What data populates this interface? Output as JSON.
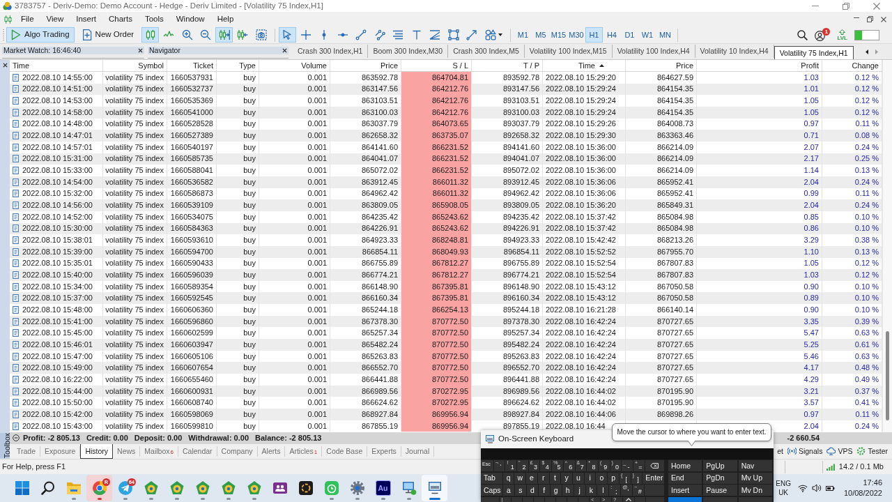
{
  "window": {
    "title": "3783757 - Deriv-Demo: Demo Account - Hedge - Deriv Limited - [Volatility 75 Index,H1]"
  },
  "menu": [
    "File",
    "View",
    "Insert",
    "Charts",
    "Tools",
    "Window",
    "Help"
  ],
  "toolbar": {
    "buttons": [
      {
        "kind": "algo",
        "label": "Algo Trading",
        "selected": true
      },
      {
        "kind": "order",
        "label": "New Order",
        "selected": false
      }
    ],
    "chart_tools": [
      {
        "kind": "bars",
        "selected": true
      },
      {
        "kind": "line",
        "selected": false
      },
      {
        "kind": "zoomin",
        "selected": false
      },
      {
        "kind": "zoomout",
        "selected": false
      },
      {
        "kind": "shift",
        "selected": true
      },
      {
        "kind": "autoscroll",
        "selected": false
      },
      {
        "kind": "screenshot",
        "selected": false
      }
    ],
    "draw_tools": [
      {
        "kind": "cursor",
        "selected": true
      },
      {
        "kind": "crosshair",
        "selected": false
      },
      {
        "kind": "vline",
        "selected": false
      },
      {
        "kind": "hline",
        "selected": false
      },
      {
        "kind": "trend",
        "selected": false
      },
      {
        "kind": "channel",
        "selected": false
      },
      {
        "kind": "fibo",
        "selected": false
      },
      {
        "kind": "text",
        "selected": false
      },
      {
        "kind": "fan",
        "selected": false
      },
      {
        "kind": "rect",
        "selected": false
      },
      {
        "kind": "arrow",
        "selected": false
      },
      {
        "kind": "shapes",
        "selected": false
      }
    ],
    "timeframes": [
      {
        "label": "M1",
        "selected": false
      },
      {
        "label": "M5",
        "selected": false
      },
      {
        "label": "M15",
        "selected": false
      },
      {
        "label": "M30",
        "selected": false
      },
      {
        "label": "H1",
        "selected": true
      },
      {
        "label": "H4",
        "selected": false
      },
      {
        "label": "D1",
        "selected": false
      },
      {
        "label": "W1",
        "selected": false
      },
      {
        "label": "MN",
        "selected": false
      }
    ],
    "notifications_badge": "1",
    "level_label": "LVL",
    "meter": {
      "level": 0.28
    }
  },
  "panels": [
    {
      "title": "Market Watch: 16:46:40"
    },
    {
      "title": "Navigator"
    }
  ],
  "chart_tabs": [
    {
      "label": "Crash 300 Index,H1",
      "selected": false
    },
    {
      "label": "Boom 300 Index,M30",
      "selected": false
    },
    {
      "label": "Crash 300 Index,M5",
      "selected": false
    },
    {
      "label": "Volatility 100 Index,M15",
      "selected": false
    },
    {
      "label": "Volatility 100 Index,H4",
      "selected": false
    },
    {
      "label": "Volatility 10 Index,H4",
      "selected": false
    },
    {
      "label": "Volatility 75 Index,H1",
      "selected": true
    }
  ],
  "table": {
    "columns": [
      {
        "label": "Time",
        "sorted": false,
        "highlighted": false
      },
      {
        "label": "Symbol",
        "sorted": false,
        "highlighted": false
      },
      {
        "label": "Ticket",
        "sorted": false,
        "highlighted": false
      },
      {
        "label": "Type",
        "sorted": false,
        "highlighted": false
      },
      {
        "label": "Volume",
        "sorted": false,
        "highlighted": false
      },
      {
        "label": "Price",
        "sorted": false,
        "highlighted": false
      },
      {
        "label": "S / L",
        "sorted": false,
        "highlighted": true
      },
      {
        "label": "T / P",
        "sorted": false,
        "highlighted": false
      },
      {
        "label": "Time",
        "sorted": true,
        "highlighted": false
      },
      {
        "label": "Price",
        "sorted": false,
        "highlighted": false
      },
      {
        "label": "Profit",
        "sorted": false,
        "highlighted": false
      },
      {
        "label": "Change",
        "sorted": false,
        "highlighted": false
      }
    ],
    "rows": [
      {
        "cells": [
          "2022.08.10 14:55:00",
          "volatility 75 index",
          "1660537931",
          "buy",
          "0.001",
          "863592.78",
          "864704.81",
          "893592.78",
          "2022.08.10 15:29:20",
          "864627.59",
          "1.03",
          "0.12 %"
        ]
      },
      {
        "cells": [
          "2022.08.10 14:51:00",
          "volatility 75 index",
          "1660532737",
          "buy",
          "0.001",
          "863147.56",
          "864212.76",
          "893147.56",
          "2022.08.10 15:29:24",
          "864154.35",
          "1.01",
          "0.12 %"
        ]
      },
      {
        "cells": [
          "2022.08.10 14:53:00",
          "volatility 75 index",
          "1660535369",
          "buy",
          "0.001",
          "863103.51",
          "864212.76",
          "893103.51",
          "2022.08.10 15:29:24",
          "864154.35",
          "1.05",
          "0.12 %"
        ]
      },
      {
        "cells": [
          "2022.08.10 14:58:00",
          "volatility 75 index",
          "1660541000",
          "buy",
          "0.001",
          "863100.03",
          "864212.76",
          "893100.03",
          "2022.08.10 15:29:24",
          "864154.35",
          "1.05",
          "0.12 %"
        ]
      },
      {
        "cells": [
          "2022.08.10 14:48:00",
          "volatility 75 index",
          "1660528528",
          "buy",
          "0.001",
          "863037.79",
          "864073.65",
          "893037.79",
          "2022.08.10 15:29:26",
          "864008.73",
          "0.97",
          "0.11 %"
        ]
      },
      {
        "cells": [
          "2022.08.10 14:47:01",
          "volatility 75 index",
          "1660527389",
          "buy",
          "0.001",
          "862658.32",
          "863735.07",
          "892658.32",
          "2022.08.10 15:29:30",
          "863363.46",
          "0.71",
          "0.08 %"
        ]
      },
      {
        "cells": [
          "2022.08.10 14:57:01",
          "volatility 75 index",
          "1660540197",
          "buy",
          "0.001",
          "864141.60",
          "866231.52",
          "894141.60",
          "2022.08.10 15:36:00",
          "866214.09",
          "2.07",
          "0.24 %"
        ]
      },
      {
        "cells": [
          "2022.08.10 15:31:00",
          "volatility 75 index",
          "1660585735",
          "buy",
          "0.001",
          "864041.07",
          "866231.52",
          "894041.07",
          "2022.08.10 15:36:00",
          "866214.09",
          "2.17",
          "0.25 %"
        ]
      },
      {
        "cells": [
          "2022.08.10 15:33:00",
          "volatility 75 index",
          "1660588041",
          "buy",
          "0.001",
          "865072.02",
          "866231.52",
          "895072.02",
          "2022.08.10 15:36:00",
          "866214.09",
          "1.14",
          "0.13 %"
        ]
      },
      {
        "cells": [
          "2022.08.10 14:54:00",
          "volatility 75 index",
          "1660536582",
          "buy",
          "0.001",
          "863912.45",
          "866011.32",
          "893912.45",
          "2022.08.10 15:36:06",
          "865952.41",
          "2.04",
          "0.24 %"
        ]
      },
      {
        "cells": [
          "2022.08.10 15:32:00",
          "volatility 75 index",
          "1660586873",
          "buy",
          "0.001",
          "864962.42",
          "866011.32",
          "894962.42",
          "2022.08.10 15:36:06",
          "865952.41",
          "0.99",
          "0.11 %"
        ]
      },
      {
        "cells": [
          "2022.08.10 14:56:00",
          "volatility 75 index",
          "1660539109",
          "buy",
          "0.001",
          "863809.05",
          "865908.05",
          "893809.05",
          "2022.08.10 15:36:20",
          "865849.31",
          "2.04",
          "0.24 %"
        ]
      },
      {
        "cells": [
          "2022.08.10 14:52:00",
          "volatility 75 index",
          "1660534075",
          "buy",
          "0.001",
          "864235.42",
          "865243.62",
          "894235.42",
          "2022.08.10 15:37:42",
          "865084.98",
          "0.85",
          "0.10 %"
        ]
      },
      {
        "cells": [
          "2022.08.10 15:30:00",
          "volatility 75 index",
          "1660584363",
          "buy",
          "0.001",
          "864226.91",
          "865243.62",
          "894226.91",
          "2022.08.10 15:37:42",
          "865084.98",
          "0.86",
          "0.10 %"
        ]
      },
      {
        "cells": [
          "2022.08.10 15:38:01",
          "volatility 75 index",
          "1660593610",
          "buy",
          "0.001",
          "864923.33",
          "868248.81",
          "894923.33",
          "2022.08.10 15:42:42",
          "868213.26",
          "3.29",
          "0.38 %"
        ]
      },
      {
        "cells": [
          "2022.08.10 15:39:00",
          "volatility 75 index",
          "1660594700",
          "buy",
          "0.001",
          "866854.11",
          "868049.93",
          "896854.11",
          "2022.08.10 15:52:52",
          "867955.70",
          "1.10",
          "0.13 %"
        ]
      },
      {
        "cells": [
          "2022.08.10 15:35:01",
          "volatility 75 index",
          "1660590433",
          "buy",
          "0.001",
          "866755.89",
          "867812.27",
          "896755.89",
          "2022.08.10 15:52:54",
          "867807.83",
          "1.05",
          "0.12 %"
        ]
      },
      {
        "cells": [
          "2022.08.10 15:40:00",
          "volatility 75 index",
          "1660596039",
          "buy",
          "0.001",
          "866774.21",
          "867812.27",
          "896774.21",
          "2022.08.10 15:52:54",
          "867807.83",
          "1.03",
          "0.12 %"
        ]
      },
      {
        "cells": [
          "2022.08.10 15:34:00",
          "volatility 75 index",
          "1660589354",
          "buy",
          "0.001",
          "866148.90",
          "867395.81",
          "896148.90",
          "2022.08.10 15:43:12",
          "867050.58",
          "0.90",
          "0.10 %"
        ]
      },
      {
        "cells": [
          "2022.08.10 15:37:00",
          "volatility 75 index",
          "1660592545",
          "buy",
          "0.001",
          "866160.34",
          "867395.81",
          "896160.34",
          "2022.08.10 15:43:12",
          "867050.58",
          "0.89",
          "0.10 %"
        ]
      },
      {
        "cells": [
          "2022.08.10 15:48:00",
          "volatility 75 index",
          "1660606360",
          "buy",
          "0.001",
          "865244.18",
          "866254.13",
          "895244.18",
          "2022.08.10 16:21:28",
          "866140.14",
          "0.90",
          "0.10 %"
        ]
      },
      {
        "cells": [
          "2022.08.10 15:41:00",
          "volatility 75 index",
          "1660596860",
          "buy",
          "0.001",
          "867378.30",
          "870772.50",
          "897378.30",
          "2022.08.10 16:42:24",
          "870727.65",
          "3.35",
          "0.39 %"
        ]
      },
      {
        "cells": [
          "2022.08.10 15:45:00",
          "volatility 75 index",
          "1660602599",
          "buy",
          "0.001",
          "865257.34",
          "870772.50",
          "895257.34",
          "2022.08.10 16:42:24",
          "870727.65",
          "5.47",
          "0.63 %"
        ]
      },
      {
        "cells": [
          "2022.08.10 15:46:01",
          "volatility 75 index",
          "1660603947",
          "buy",
          "0.001",
          "865482.24",
          "870772.50",
          "895482.24",
          "2022.08.10 16:42:24",
          "870727.65",
          "5.25",
          "0.61 %"
        ]
      },
      {
        "cells": [
          "2022.08.10 15:47:00",
          "volatility 75 index",
          "1660605106",
          "buy",
          "0.001",
          "865263.83",
          "870772.50",
          "895263.83",
          "2022.08.10 16:42:24",
          "870727.65",
          "5.46",
          "0.63 %"
        ]
      },
      {
        "cells": [
          "2022.08.10 15:49:00",
          "volatility 75 index",
          "1660607654",
          "buy",
          "0.001",
          "866552.70",
          "870772.50",
          "896552.70",
          "2022.08.10 16:42:24",
          "870727.65",
          "4.17",
          "0.48 %"
        ]
      },
      {
        "cells": [
          "2022.08.10 16:22:00",
          "volatility 75 index",
          "1660655460",
          "buy",
          "0.001",
          "866441.88",
          "870772.50",
          "896441.88",
          "2022.08.10 16:42:24",
          "870727.65",
          "4.29",
          "0.49 %"
        ]
      },
      {
        "cells": [
          "2022.08.10 15:44:00",
          "volatility 75 index",
          "1660600931",
          "buy",
          "0.001",
          "866989.56",
          "870272.95",
          "896989.56",
          "2022.08.10 16:44:02",
          "870195.90",
          "3.21",
          "0.37 %"
        ]
      },
      {
        "cells": [
          "2022.08.10 15:50:00",
          "volatility 75 index",
          "1660608740",
          "buy",
          "0.001",
          "866624.62",
          "870272.95",
          "896624.62",
          "2022.08.10 16:44:02",
          "870195.90",
          "3.57",
          "0.41 %"
        ]
      },
      {
        "cells": [
          "2022.08.10 15:42:00",
          "volatility 75 index",
          "1660598069",
          "buy",
          "0.001",
          "868927.84",
          "869956.94",
          "898927.84",
          "2022.08.10 16:44:06",
          "869898.26",
          "0.97",
          "0.11 %"
        ]
      },
      {
        "cells": [
          "2022.08.10 15:43:00",
          "volatility 75 index",
          "1660599810",
          "buy",
          "0.001",
          "867855.19",
          "869956.94",
          "897855.19",
          "2022.08.10 16:44",
          null,
          "2.04",
          "0.24 %"
        ]
      }
    ]
  },
  "summary": {
    "items": [
      "Profit: -2 805.13",
      "Credit: 0.00",
      "Deposit: 0.00",
      "Withdrawal: 0.00",
      "Balance: -2 805.13"
    ],
    "total": "-2 660.54"
  },
  "toolbox": {
    "label": "Toolbox",
    "tabs": [
      {
        "label": "Trade",
        "selected": false
      },
      {
        "label": "Exposure",
        "selected": false
      },
      {
        "label": "History",
        "selected": true
      },
      {
        "label": "News",
        "selected": false
      },
      {
        "label": "Mailbox",
        "selected": false,
        "badge": "6"
      },
      {
        "label": "Calendar",
        "selected": false
      },
      {
        "label": "Company",
        "selected": false
      },
      {
        "label": "Alerts",
        "selected": false
      },
      {
        "label": "Articles",
        "selected": false,
        "badge": "1"
      },
      {
        "label": "Code Base",
        "selected": false
      },
      {
        "label": "Experts",
        "selected": false
      },
      {
        "label": "Journal",
        "selected": false
      }
    ],
    "services": [
      {
        "kind": "plain",
        "label": "et"
      },
      {
        "kind": "signals",
        "label": "Signals"
      },
      {
        "kind": "vps",
        "label": "VPS"
      },
      {
        "kind": "tester",
        "label": "Tester"
      }
    ]
  },
  "status_bar": {
    "help": "For Help, press F1",
    "memory": "14.2 / 0.1 Mb"
  },
  "taskbar": {
    "apps": [
      {
        "kind": "start",
        "running": false,
        "active": false,
        "flashing": false
      },
      {
        "kind": "search",
        "running": false,
        "active": false,
        "flashing": false
      },
      {
        "kind": "folder",
        "running": true,
        "active": false,
        "flashing": false
      },
      {
        "kind": "browser",
        "running": true,
        "active": false,
        "flashing": true,
        "badge": "R"
      },
      {
        "kind": "messenger",
        "running": true,
        "active": false,
        "flashing": false,
        "badge": "64"
      },
      {
        "kind": "trader",
        "running": true,
        "active": false,
        "flashing": false
      },
      {
        "kind": "trader",
        "running": true,
        "active": false,
        "flashing": false
      },
      {
        "kind": "trader",
        "running": true,
        "active": false,
        "flashing": false
      },
      {
        "kind": "trader",
        "running": true,
        "active": false,
        "flashing": false
      },
      {
        "kind": "trader",
        "running": true,
        "active": false,
        "flashing": false
      },
      {
        "kind": "meeting",
        "running": false,
        "active": false,
        "flashing": false
      },
      {
        "kind": "ring",
        "running": false,
        "active": false,
        "flashing": false
      },
      {
        "kind": "timer",
        "running": true,
        "active": false,
        "flashing": false
      },
      {
        "kind": "gear",
        "running": true,
        "active": false,
        "flashing": false
      },
      {
        "kind": "tile",
        "running": true,
        "active": false,
        "flashing": false,
        "label": "Au"
      },
      {
        "kind": "computer",
        "running": true,
        "active": false,
        "flashing": false
      },
      {
        "kind": "keyboard",
        "running": true,
        "active": true,
        "flashing": false
      }
    ],
    "tray": {
      "language": "ENG",
      "region": "UK",
      "time": "17:46",
      "date": "10/08/2022"
    }
  },
  "keyboard": {
    "title": "On-Screen Keyboard",
    "tooltip": "Move the cursor to where you want to enter text.",
    "rows": [
      {
        "keys": [
          {
            "kind": "fn",
            "label": "Esc"
          },
          {
            "kind": "char",
            "label": "`",
            "shift": "¬"
          },
          {
            "kind": "char",
            "label": "1",
            "shift": "!"
          },
          {
            "kind": "char",
            "label": "2",
            "shift": "\""
          },
          {
            "kind": "char",
            "label": "3",
            "shift": "£"
          },
          {
            "kind": "char",
            "label": "4",
            "shift": "$"
          },
          {
            "kind": "char",
            "label": "5",
            "shift": "%"
          },
          {
            "kind": "char",
            "label": "6",
            "shift": "^"
          },
          {
            "kind": "char",
            "label": "7",
            "shift": "&"
          },
          {
            "kind": "char",
            "label": "8",
            "shift": "*"
          },
          {
            "kind": "char",
            "label": "9",
            "shift": "("
          },
          {
            "kind": "char",
            "label": "0",
            "shift": ")"
          },
          {
            "kind": "char",
            "label": "-",
            "shift": "_"
          },
          {
            "kind": "char",
            "label": "=",
            "shift": "+"
          },
          {
            "kind": "backspace"
          }
        ]
      },
      {
        "keys": [
          {
            "kind": "wide",
            "label": "Tab"
          },
          {
            "kind": "char",
            "label": "q"
          },
          {
            "kind": "char",
            "label": "w"
          },
          {
            "kind": "char",
            "label": "e"
          },
          {
            "kind": "char",
            "label": "r"
          },
          {
            "kind": "char",
            "label": "t"
          },
          {
            "kind": "char",
            "label": "y"
          },
          {
            "kind": "char",
            "label": "u"
          },
          {
            "kind": "char",
            "label": "i"
          },
          {
            "kind": "char",
            "label": "o"
          },
          {
            "kind": "char",
            "label": "p"
          },
          {
            "kind": "char",
            "label": "[",
            "shift": "{"
          },
          {
            "kind": "char",
            "label": "]",
            "shift": "}"
          },
          {
            "kind": "wide",
            "label": "Enter"
          }
        ]
      },
      {
        "keys": [
          {
            "kind": "wide",
            "label": "Caps"
          },
          {
            "kind": "char",
            "label": "a"
          },
          {
            "kind": "char",
            "label": "s"
          },
          {
            "kind": "char",
            "label": "d"
          },
          {
            "kind": "char",
            "label": "f"
          },
          {
            "kind": "char",
            "label": "g"
          },
          {
            "kind": "char",
            "label": "h"
          },
          {
            "kind": "char",
            "label": "j"
          },
          {
            "kind": "char",
            "label": "k"
          },
          {
            "kind": "char",
            "label": "l"
          },
          {
            "kind": "char",
            "label": ";",
            "shift": ":"
          },
          {
            "kind": "char",
            "label": "'",
            "shift": "@"
          },
          {
            "kind": "char",
            "label": "#",
            "shift": "~"
          },
          {
            "kind": "blank"
          }
        ]
      },
      {
        "keys": [
          {
            "kind": "blank"
          },
          {
            "kind": "char",
            "shift": "|"
          },
          {
            "kind": "key"
          },
          {
            "kind": "key"
          },
          {
            "kind": "key"
          },
          {
            "kind": "key"
          },
          {
            "kind": "key"
          },
          {
            "kind": "key"
          },
          {
            "kind": "key"
          },
          {
            "kind": "char",
            "shift": "<"
          },
          {
            "kind": "char",
            "shift": ">"
          },
          {
            "kind": "char",
            "shift": "?"
          },
          {
            "kind": "up"
          },
          {
            "kind": "key"
          },
          {
            "kind": "blank"
          }
        ]
      }
    ],
    "nav_rows": [
      [
        {
          "label": "Home",
          "highlighted": false
        },
        {
          "label": "PgUp",
          "highlighted": false
        },
        {
          "label": "Nav",
          "highlighted": false
        }
      ],
      [
        {
          "label": "End",
          "highlighted": false
        },
        {
          "label": "PgDn",
          "highlighted": false
        },
        {
          "label": "Mv Up",
          "highlighted": false
        }
      ],
      [
        {
          "label": "Insert",
          "highlighted": false
        },
        {
          "label": "Pause",
          "highlighted": false
        },
        {
          "label": "Mv Dn",
          "highlighted": false
        }
      ],
      [
        {
          "highlighted": true
        },
        {
          "highlighted": false
        },
        {
          "highlighted": false
        }
      ]
    ]
  }
}
